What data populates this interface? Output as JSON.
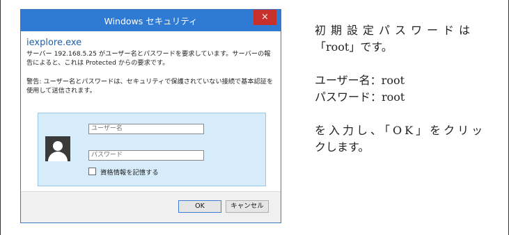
{
  "dialog": {
    "title": "Windows セキュリティ",
    "close_glyph": "×",
    "app_name": "iexplore.exe",
    "message": "サーバー 192.168.5.25 がユーザー名とパスワードを要求しています。サーバーの報告によると、これは Protected からの要求です。",
    "warning": "警告: ユーザー名とパスワードは、セキュリティで保護されていない接続で基本認証を使用して送信されます。",
    "username_placeholder": "ユーザー名",
    "password_placeholder": "パスワード",
    "remember_label": "資格情報を記憶する",
    "ok_label": "OK",
    "cancel_label": "キャンセル",
    "accent_color": "#2f7bd3",
    "close_color": "#c7302b"
  },
  "instructions": {
    "line1": "初期設定パスワードは",
    "line2": "「root」です。",
    "username_line": "ユーザー名：root",
    "password_line": "パスワード：root",
    "action_line1": "を入力し、「OK」をクリッ",
    "action_line2": "クします。"
  },
  "icons": {
    "avatar": "user-silhouette-icon",
    "close": "close-icon"
  }
}
